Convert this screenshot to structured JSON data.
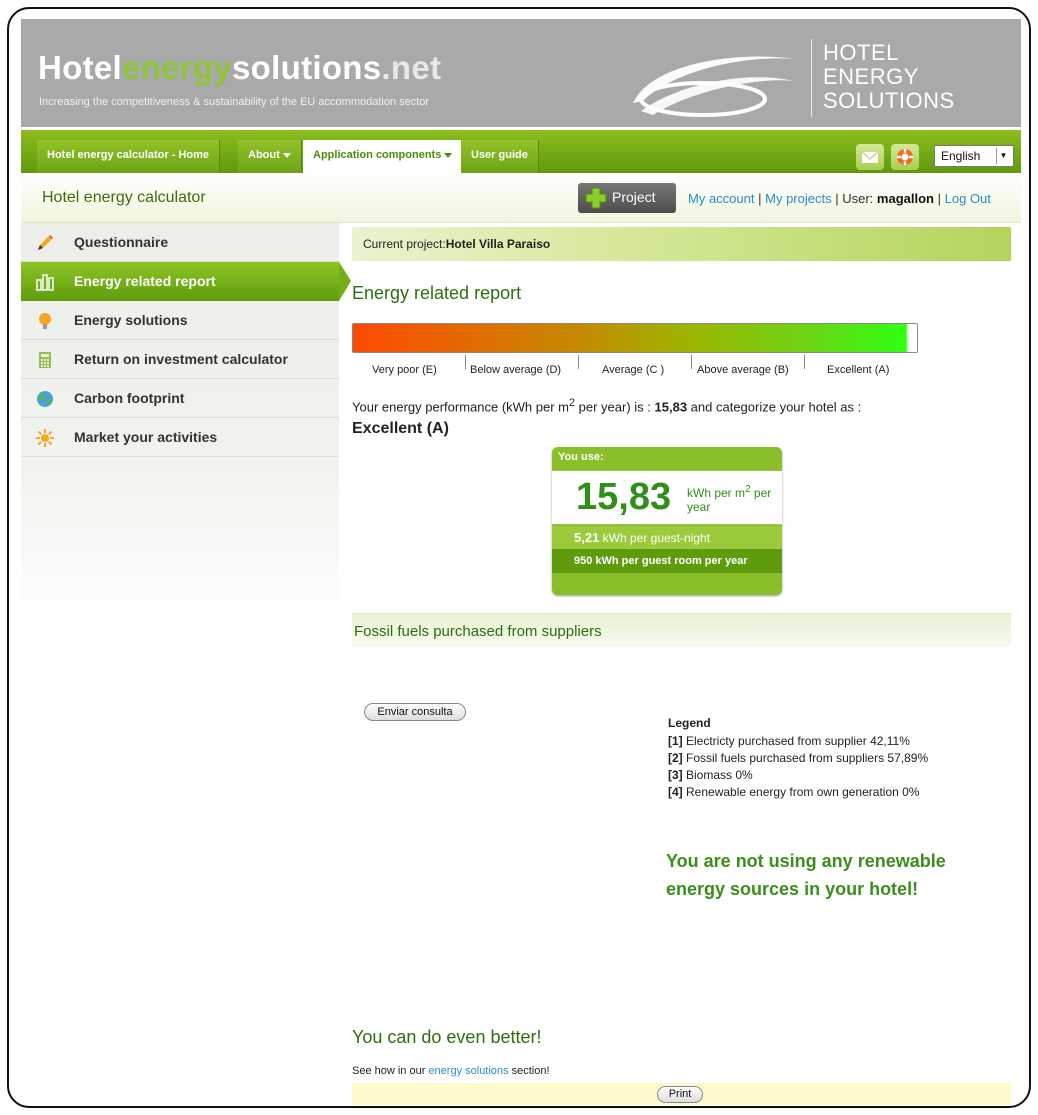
{
  "header": {
    "logo_part1": "Hotel",
    "logo_part2": "energy",
    "logo_part3": "solutions",
    "logo_part4": ".net",
    "tagline": "Increasing the competitiveness & sustainability of the EU accommodation sector",
    "brand_line1": "HOTEL",
    "brand_line2": "ENERGY",
    "brand_line3": "SOLUTIONS"
  },
  "nav": {
    "items": [
      {
        "label": "Hotel energy calculator - Home"
      },
      {
        "label": "About"
      },
      {
        "label": "Application components"
      },
      {
        "label": "User guide"
      }
    ],
    "language": "English"
  },
  "subheader": {
    "title": "Hotel energy calculator",
    "project_button": "Project",
    "my_account": "My account",
    "my_projects": "My projects",
    "user_prefix": "User:",
    "user_name": "magallon",
    "logout": "Log Out",
    "sep": "|"
  },
  "sidebar": {
    "items": [
      {
        "label": "Questionnaire",
        "icon": "pencil-icon"
      },
      {
        "label": "Energy related report",
        "icon": "bar-chart-icon"
      },
      {
        "label": "Energy solutions",
        "icon": "lightbulb-icon"
      },
      {
        "label": "Return on investment calculator",
        "icon": "calculator-icon"
      },
      {
        "label": "Carbon footprint",
        "icon": "globe-icon"
      },
      {
        "label": "Market your activities",
        "icon": "sun-icon"
      }
    ]
  },
  "main": {
    "current_project_label": "Current project:",
    "current_project_name": "Hotel Villa Paraiso",
    "report_title": "Energy related report",
    "scale_labels": [
      "Very poor (E)",
      "Below average (D)",
      "Average (C )",
      "Above average (B)",
      "Excellent (A)"
    ],
    "perf_text_before": "Your energy performance (kWh per m",
    "perf_sup": "2",
    "perf_text_mid": " per year) is : ",
    "perf_value": "15,83",
    "perf_text_after": " and categorize your hotel as :",
    "grade": "Excellent (A)",
    "use_box": {
      "heading": "You use:",
      "value": "15,83",
      "unit_line1": "kWh per m",
      "unit_sup": "2",
      "unit_line1_after": " per",
      "unit_line2": "year",
      "guest_night_value": "5,21",
      "guest_night_label": " kWh per guest-night",
      "room_year": "950 kWh per guest room per year"
    },
    "fossil_title": "Fossil fuels purchased from suppliers",
    "query_button": "Enviar consulta",
    "legend": {
      "title": "Legend",
      "items": [
        {
          "key": "[1]",
          "text": " Electricty purchased from supplier 42,11%"
        },
        {
          "key": "[2]",
          "text": " Fossil fuels purchased from suppliers 57,89%"
        },
        {
          "key": "[3]",
          "text": " Biomass 0%"
        },
        {
          "key": "[4]",
          "text": " Renewable energy from own generation 0%"
        }
      ]
    },
    "renewable_msg": "You are not using any renewable energy sources in your hotel!",
    "better_title": "You can do even better!",
    "see_how_before": "See how in our ",
    "see_how_link": "energy solutions",
    "see_how_after": " section!",
    "print_button": "Print"
  },
  "colors": {
    "brand_green": "#6ba214",
    "heading_green": "#2f6d12",
    "link_blue": "#2b8bc9",
    "banner_gray": "#a9a9a9"
  }
}
